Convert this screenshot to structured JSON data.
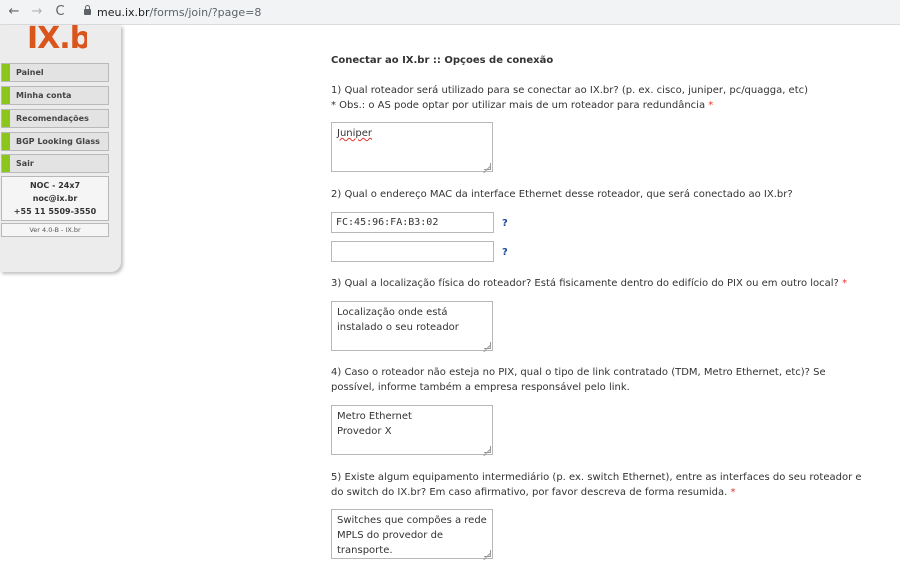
{
  "browser": {
    "back": "←",
    "forward": "→",
    "reload": "C",
    "url_host": "meu.ix.br",
    "url_path": "/forms/join/?page=8"
  },
  "sidebar": {
    "logo": "IX.br",
    "items": [
      {
        "label": "Painel"
      },
      {
        "label": "Minha conta"
      },
      {
        "label": "Recomendações"
      },
      {
        "label": "BGP Looking Glass"
      },
      {
        "label": "Sair"
      }
    ],
    "noc": {
      "title": "NOC - 24x7",
      "email": "noc@ix.br",
      "phone": "+55 11 5509-3550"
    },
    "version": "Ver 4.0-B - IX.br"
  },
  "main": {
    "title": "Conectar ao IX.br :: Opçoes de conexão",
    "q1": {
      "text": "1) Qual roteador será utilizado para se conectar ao IX.br? (p. ex. cisco, juniper, pc/quagga, etc)",
      "note": "* Obs.: o AS pode optar por utilizar mais de um roteador para redundância",
      "required": "*",
      "value": "Juniper"
    },
    "q2": {
      "text": "2) Qual o endereço MAC da interface Ethernet desse roteador, que será conectado ao IX.br?",
      "mac1": "FC:45:96:FA:B3:02",
      "mac2": "",
      "help": "?"
    },
    "q3": {
      "text": "3) Qual a localização física do roteador? Está fisicamente dentro do edifício do PIX ou em outro local?",
      "required": "*",
      "value_line1": "Localização onde está",
      "value_line2": "instalado o seu roteador"
    },
    "q4": {
      "text_line1": "4) Caso o roteador não esteja no PIX, qual o tipo de link contratado (TDM, Metro Ethernet, etc)? Se",
      "text_line2": "possível, informe também a empresa responsável pelo link.",
      "value_line1": "Metro Ethernet",
      "value_line2": "Provedor X"
    },
    "q5": {
      "text_line1": "5) Existe algum equipamento intermediário (p. ex. switch Ethernet), entre as interfaces do seu roteador e",
      "text_line2": "do switch do IX.br? Em caso afirmativo, por favor descreva de forma resumida.",
      "required": "*",
      "value_line1": "Switches que compões a rede",
      "value_line2": "MPLS do provedor de",
      "value_line3": "transporte."
    }
  }
}
